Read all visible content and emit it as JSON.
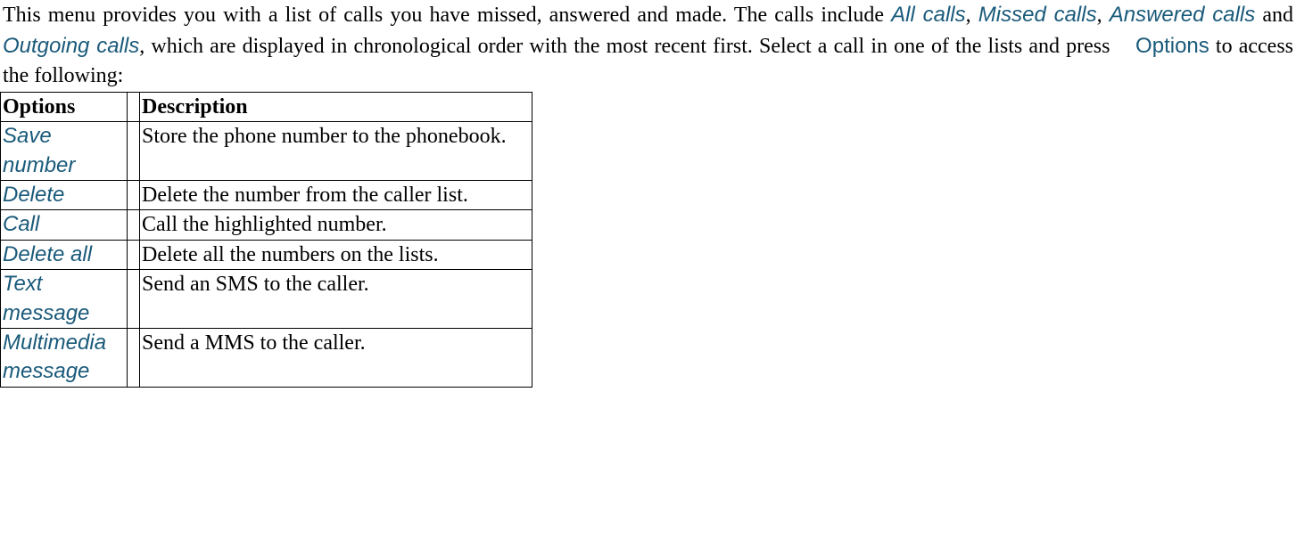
{
  "intro": {
    "part1": "This menu provides you with a list of calls you have missed, answered and made. The calls include ",
    "all_calls": "All calls",
    "sep1": ", ",
    "missed_calls": "Missed calls",
    "sep2": ", ",
    "answered_calls": "Answered calls",
    "sep3": " and ",
    "outgoing_calls": "Outgoing calls",
    "part2": ", which are displayed in chronological order with the most recent first. Select a call in one of the lists and press ",
    "options_link": "Options",
    "part3": " to access the following:"
  },
  "table": {
    "header": {
      "options": "Options",
      "description": "Description"
    },
    "rows": [
      {
        "option": "Save number",
        "description": "Store the phone number to the phonebook."
      },
      {
        "option": "Delete",
        "description": "Delete the number from the caller list."
      },
      {
        "option": "Call",
        "description": "Call the highlighted number."
      },
      {
        "option": "Delete all",
        "description": "Delete all the numbers on the lists."
      },
      {
        "option": "Text message",
        "description": "Send an SMS to the caller."
      },
      {
        "option": "Multimedia message",
        "description": "Send a MMS to the caller."
      }
    ]
  }
}
